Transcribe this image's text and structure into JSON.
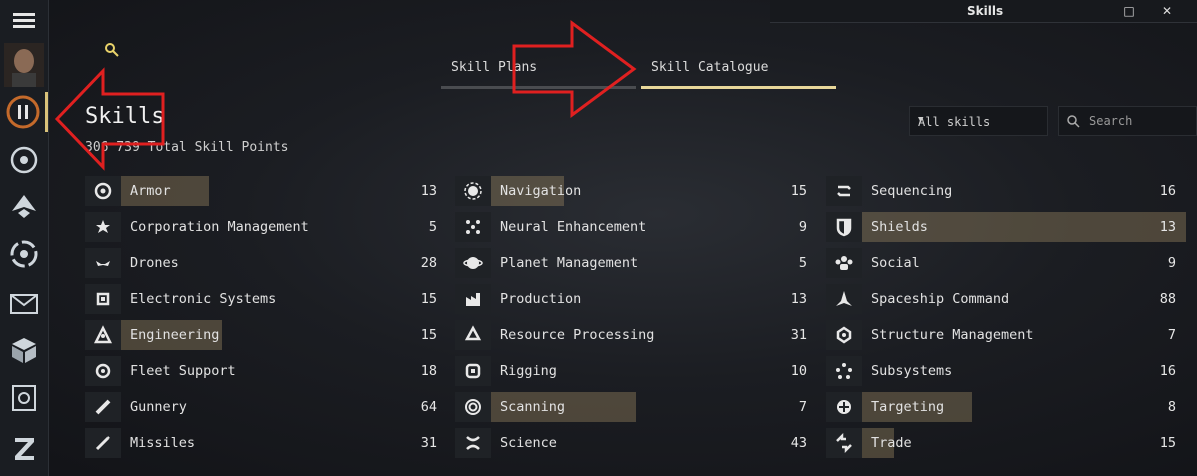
{
  "window": {
    "title": "Skills",
    "maximize_glyph": "□",
    "close_glyph": "✕"
  },
  "tabs": [
    {
      "label": "Skill Plans",
      "active": false
    },
    {
      "label": "Skill Catalogue",
      "active": true
    }
  ],
  "header": {
    "title": "Skills",
    "total_points": "306 739 Total Skill Points"
  },
  "filter": {
    "selected": "All skills",
    "search_placeholder": "Search"
  },
  "accent_color": "#e8d79a",
  "annotation_color": "#e02020",
  "columns": [
    [
      {
        "name": "Armor",
        "count": "13",
        "icon": "armor-icon",
        "highlight": 0.28
      },
      {
        "name": "Corporation Management",
        "count": "5",
        "icon": "corporation-icon",
        "highlight": 0
      },
      {
        "name": "Drones",
        "count": "28",
        "icon": "drone-icon",
        "highlight": 0
      },
      {
        "name": "Electronic Systems",
        "count": "15",
        "icon": "electronics-icon",
        "highlight": 0
      },
      {
        "name": "Engineering",
        "count": "15",
        "icon": "engineering-icon",
        "highlight": 0.32
      },
      {
        "name": "Fleet Support",
        "count": "18",
        "icon": "fleet-icon",
        "highlight": 0
      },
      {
        "name": "Gunnery",
        "count": "64",
        "icon": "gunnery-icon",
        "highlight": 0
      },
      {
        "name": "Missiles",
        "count": "31",
        "icon": "missile-icon",
        "highlight": 0
      }
    ],
    [
      {
        "name": "Navigation",
        "count": "15",
        "icon": "navigation-icon",
        "highlight": 0.23
      },
      {
        "name": "Neural Enhancement",
        "count": "9",
        "icon": "neural-icon",
        "highlight": 0
      },
      {
        "name": "Planet Management",
        "count": "5",
        "icon": "planet-icon",
        "highlight": 0
      },
      {
        "name": "Production",
        "count": "13",
        "icon": "production-icon",
        "highlight": 0
      },
      {
        "name": "Resource Processing",
        "count": "31",
        "icon": "resource-icon",
        "highlight": 0
      },
      {
        "name": "Rigging",
        "count": "10",
        "icon": "rigging-icon",
        "highlight": 0
      },
      {
        "name": "Scanning",
        "count": "7",
        "icon": "scanning-icon",
        "highlight": 0.46
      },
      {
        "name": "Science",
        "count": "43",
        "icon": "science-icon",
        "highlight": 0
      }
    ],
    [
      {
        "name": "Sequencing",
        "count": "16",
        "icon": "sequencing-icon",
        "highlight": 0
      },
      {
        "name": "Shields",
        "count": "13",
        "icon": "shield-icon",
        "highlight": 1.0
      },
      {
        "name": "Social",
        "count": "9",
        "icon": "social-icon",
        "highlight": 0
      },
      {
        "name": "Spaceship Command",
        "count": "88",
        "icon": "spaceship-icon",
        "highlight": 0
      },
      {
        "name": "Structure Management",
        "count": "7",
        "icon": "structure-icon",
        "highlight": 0
      },
      {
        "name": "Subsystems",
        "count": "16",
        "icon": "subsystems-icon",
        "highlight": 0
      },
      {
        "name": "Targeting",
        "count": "8",
        "icon": "targeting-icon",
        "highlight": 0.34
      },
      {
        "name": "Trade",
        "count": "15",
        "icon": "trade-icon",
        "highlight": 0.1
      }
    ]
  ]
}
